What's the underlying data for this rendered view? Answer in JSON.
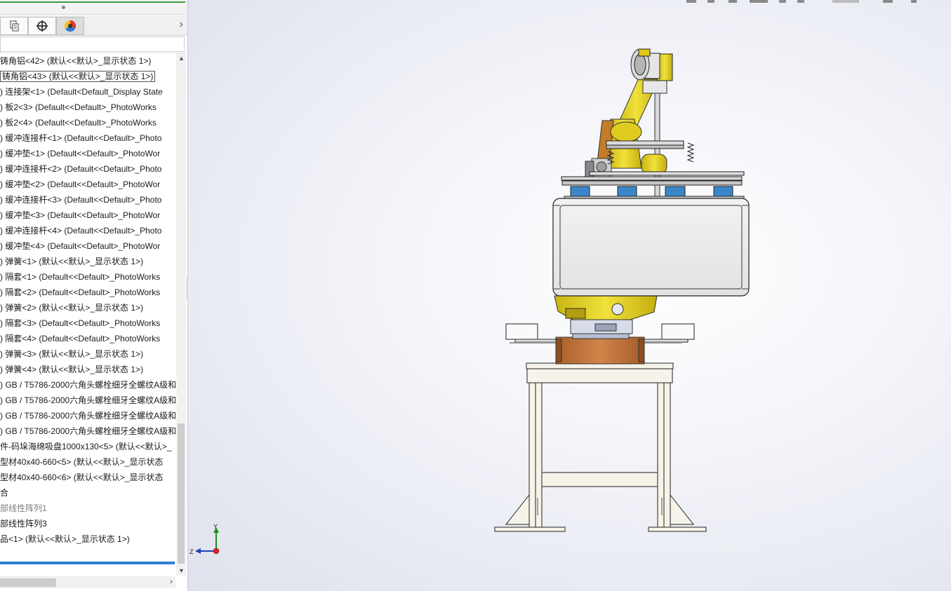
{
  "feature_tree": {
    "items": [
      "铸角铝<42> (默认<<默认>_显示状态 1>)",
      "铸角铝<43> (默认<<默认>_显示状态 1>)",
      ") 连接架<1> (Default<Default_Display State",
      ") 板2<3> (Default<<Default>_PhotoWorks",
      ") 板2<4> (Default<<Default>_PhotoWorks",
      ") 缓冲连接杆<1> (Default<<Default>_Photo",
      ") 缓冲垫<1> (Default<<Default>_PhotoWor",
      ") 缓冲连接杆<2> (Default<<Default>_Photo",
      ") 缓冲垫<2> (Default<<Default>_PhotoWor",
      ") 缓冲连接杆<3> (Default<<Default>_Photo",
      ") 缓冲垫<3> (Default<<Default>_PhotoWor",
      ") 缓冲连接杆<4> (Default<<Default>_Photo",
      ") 缓冲垫<4> (Default<<Default>_PhotoWor",
      ") 弹簧<1> (默认<<默认>_显示状态 1>)",
      ") 隔套<1> (Default<<Default>_PhotoWorks",
      ") 隔套<2> (Default<<Default>_PhotoWorks",
      ") 弹簧<2> (默认<<默认>_显示状态 1>)",
      ") 隔套<3> (Default<<Default>_PhotoWorks",
      ") 隔套<4> (Default<<Default>_PhotoWorks",
      ") 弹簧<3> (默认<<默认>_显示状态 1>)",
      ") 弹簧<4> (默认<<默认>_显示状态 1>)",
      ") GB / T5786-2000六角头螺栓细牙全螺纹A级和",
      ") GB / T5786-2000六角头螺栓细牙全螺纹A级和",
      ") GB / T5786-2000六角头螺栓细牙全螺纹A级和",
      ") GB / T5786-2000六角头螺栓细牙全螺纹A级和",
      "件-码垛海绵吸盘1000x130<5> (默认<<默认>_",
      "型材40x40-660<5> (默认<<默认>_显示状态",
      "型材40x40-660<6> (默认<<默认>_显示状态",
      "合",
      "部线性阵列1",
      "部线性阵列3",
      "品<1> (默认<<默认>_显示状态 1>)"
    ],
    "selected_index": 1,
    "grey_indices": [
      29
    ]
  },
  "tabs": [
    "configuration-manager",
    "dimxpert-manager",
    "display-manager"
  ],
  "triad": {
    "y_label": "Y",
    "z_label": "Z"
  },
  "colors": {
    "robot_yellow": "#e6d51f",
    "base_orange": "#c97a3c",
    "pad_blue": "#3a86c8",
    "selection_progress": "#2f7fd2"
  }
}
